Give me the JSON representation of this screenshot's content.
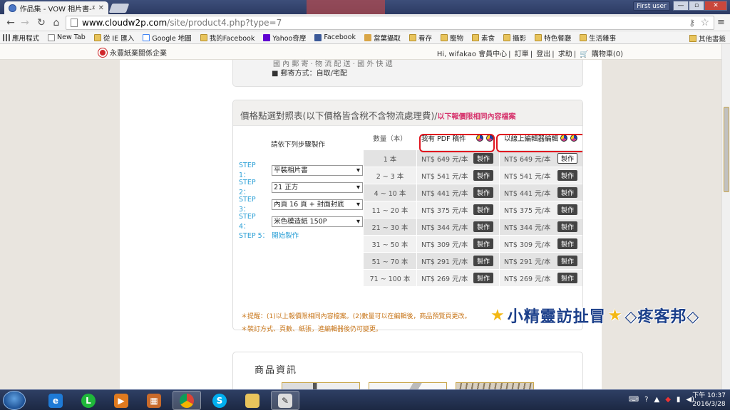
{
  "browser": {
    "tab_title": "作品集 - VOW 相片書-平",
    "profile_button": "First user",
    "url_host": "www.cloudw2p.com",
    "url_path": "/site/product4.php?type=7"
  },
  "bookmarks": [
    {
      "label": "應用程式",
      "icon": "apps-icon"
    },
    {
      "label": "New Tab",
      "icon": "page-icon"
    },
    {
      "label": "從 IE 匯入",
      "icon": "folder-icon"
    },
    {
      "label": "Google 地圖",
      "icon": "google-maps-icon"
    },
    {
      "label": "我的Facebook",
      "icon": "folder-icon"
    },
    {
      "label": "Yahoo奇摩",
      "icon": "yahoo-icon"
    },
    {
      "label": "Facebook",
      "icon": "facebook-icon"
    },
    {
      "label": "當葉攝取",
      "icon": "home-icon"
    },
    {
      "label": "看存",
      "icon": "folder-icon"
    },
    {
      "label": "寵物",
      "icon": "folder-icon"
    },
    {
      "label": "素食",
      "icon": "folder-icon"
    },
    {
      "label": "攝影",
      "icon": "folder-icon"
    },
    {
      "label": "特色餐廳",
      "icon": "folder-icon"
    },
    {
      "label": "生活雜事",
      "icon": "folder-icon"
    }
  ],
  "bookmarks_other": "其他書籤",
  "site": {
    "logo_text": "永豐紙業關係企業",
    "nav_greeting": "Hi, wifakao 會員中心",
    "nav_links": [
      "訂單",
      "登出",
      "求助"
    ],
    "cart": "購物車(0)"
  },
  "shipping": {
    "cut_text": "國 內 郵 寄 · 物 流 配 送 · 國 外 快 遞",
    "bullet_text": "■ 郵寄方式：自取/宅配"
  },
  "price_panel": {
    "title": "價格點選對照表(以下價格皆含稅不含物流處理費)",
    "title_sep": "/",
    "title_pink": "以下報價限相同內容檔案",
    "steps_title": "請依下列步驟製作",
    "steps": [
      {
        "label": "STEP 1：",
        "value": "平裝相片書"
      },
      {
        "label": "STEP 2：",
        "value": "21 正方"
      },
      {
        "label": "STEP 3：",
        "value": "內頁 16 頁 + 封面封底"
      },
      {
        "label": "STEP 4：",
        "value": "米色模造紙 150P"
      }
    ],
    "step5_label": "STEP 5：",
    "step5_link": "開始製作",
    "col_qty": "數量（本）",
    "col_pdf": "我有 PDF 稿件",
    "col_editor": "以線上編輯器編輯",
    "button_label": "製作",
    "rows": [
      {
        "qty": "1 本",
        "pdf": "NT$ 649 元/本",
        "editor": "NT$ 649 元/本"
      },
      {
        "qty": "2 ~ 3 本",
        "pdf": "NT$ 541 元/本",
        "editor": "NT$ 541 元/本"
      },
      {
        "qty": "4 ~ 10 本",
        "pdf": "NT$ 441 元/本",
        "editor": "NT$ 441 元/本"
      },
      {
        "qty": "11 ~ 20 本",
        "pdf": "NT$ 375 元/本",
        "editor": "NT$ 375 元/本"
      },
      {
        "qty": "21 ~ 30 本",
        "pdf": "NT$ 344 元/本",
        "editor": "NT$ 344 元/本"
      },
      {
        "qty": "31 ~ 50 本",
        "pdf": "NT$ 309 元/本",
        "editor": "NT$ 309 元/本"
      },
      {
        "qty": "51 ~ 70 本",
        "pdf": "NT$ 291 元/本",
        "editor": "NT$ 291 元/本"
      },
      {
        "qty": "71 ~ 100 本",
        "pdf": "NT$ 269 元/本",
        "editor": "NT$ 269 元/本"
      }
    ],
    "note1": "＊提醒：(1)以上報價限相同內容檔案。(2)數量可以在編輯後，商品預覽頁更改。",
    "note2": "＊裝訂方式、頁數、紙張，進編輯器後仍可變更。"
  },
  "product_info": {
    "title": "商品資訊"
  },
  "watermark": "小精靈訪扯冒",
  "watermark_tail": "◇疼客邦◇",
  "taskbar": {
    "time": "下午 10:37",
    "date": "2016/3/28"
  }
}
